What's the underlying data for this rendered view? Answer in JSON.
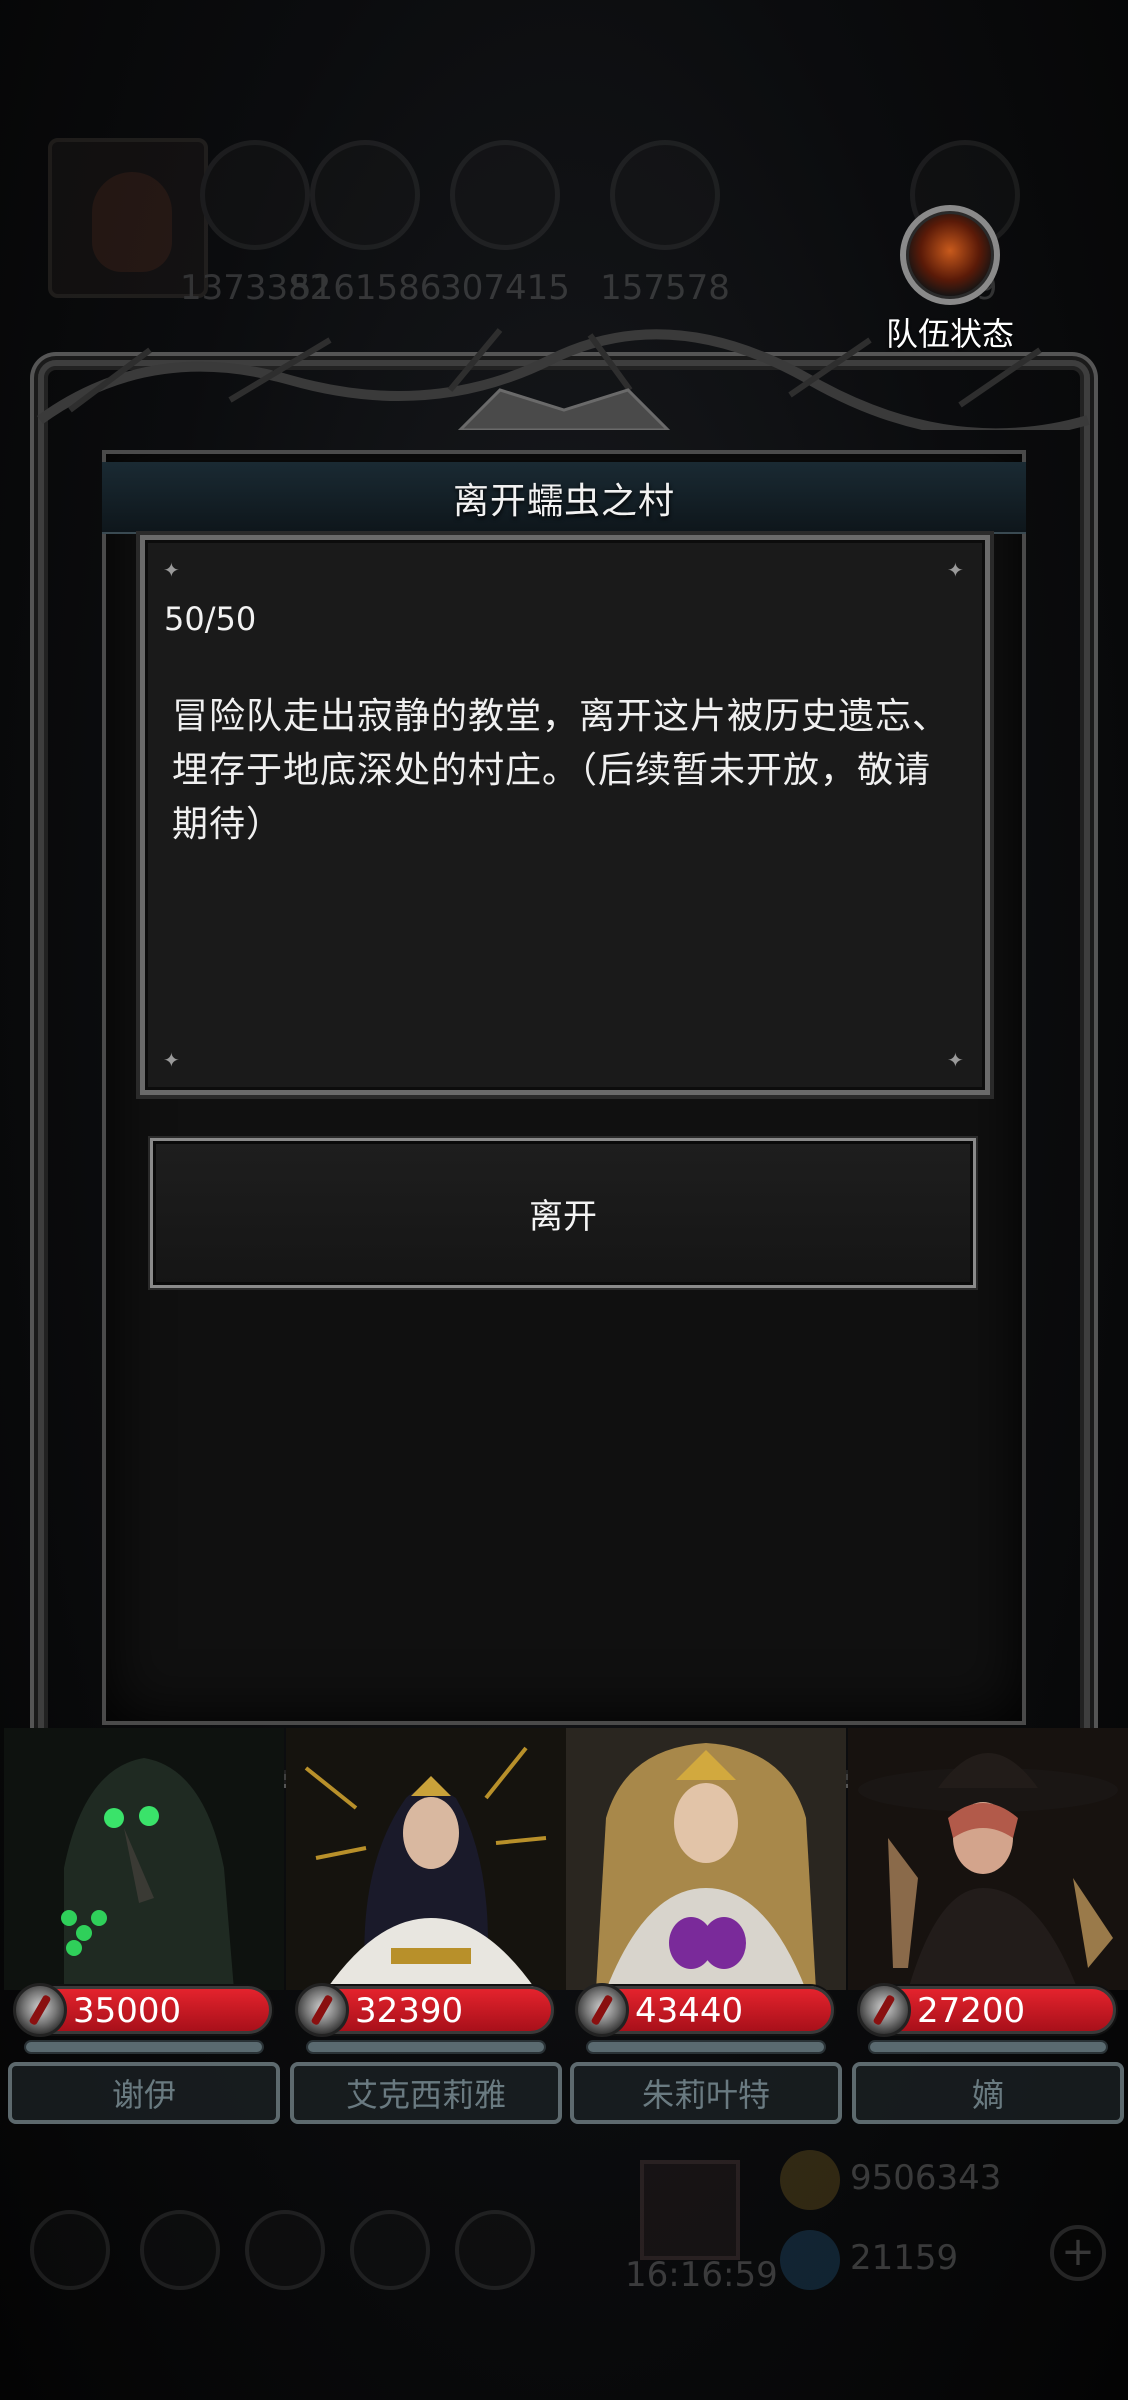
{
  "top_bar": {
    "resources": [
      "1373382",
      "5161586",
      "307415",
      "157578",
      "179"
    ]
  },
  "team_status": {
    "label": "队伍状态"
  },
  "dialog": {
    "title": "离开蠕虫之村",
    "progress": "50/50",
    "story": "冒险队走出寂静的教堂，离开这片被历史遗忘、埋存于地底深处的村庄。（后续暂未开放，敬请期待）",
    "leave_button": "离开"
  },
  "heroes": [
    {
      "name": "谢伊",
      "hp": "35000",
      "portrait_color": "#1f2a22"
    },
    {
      "name": "艾克西莉雅",
      "hp": "32390",
      "portrait_color": "#2a2418"
    },
    {
      "name": "朱莉叶特",
      "hp": "43440",
      "portrait_color": "#2e2a22"
    },
    {
      "name": "嫡",
      "hp": "27200",
      "portrait_color": "#241c18"
    }
  ],
  "bottom_bar": {
    "timer": "16:16:59",
    "coins": "9506343",
    "gems": "21159",
    "plus": "+"
  },
  "colors": {
    "hp_bar": "#d01a24",
    "title_strip": "#1a2a33",
    "frame": "#4a4a4a"
  }
}
